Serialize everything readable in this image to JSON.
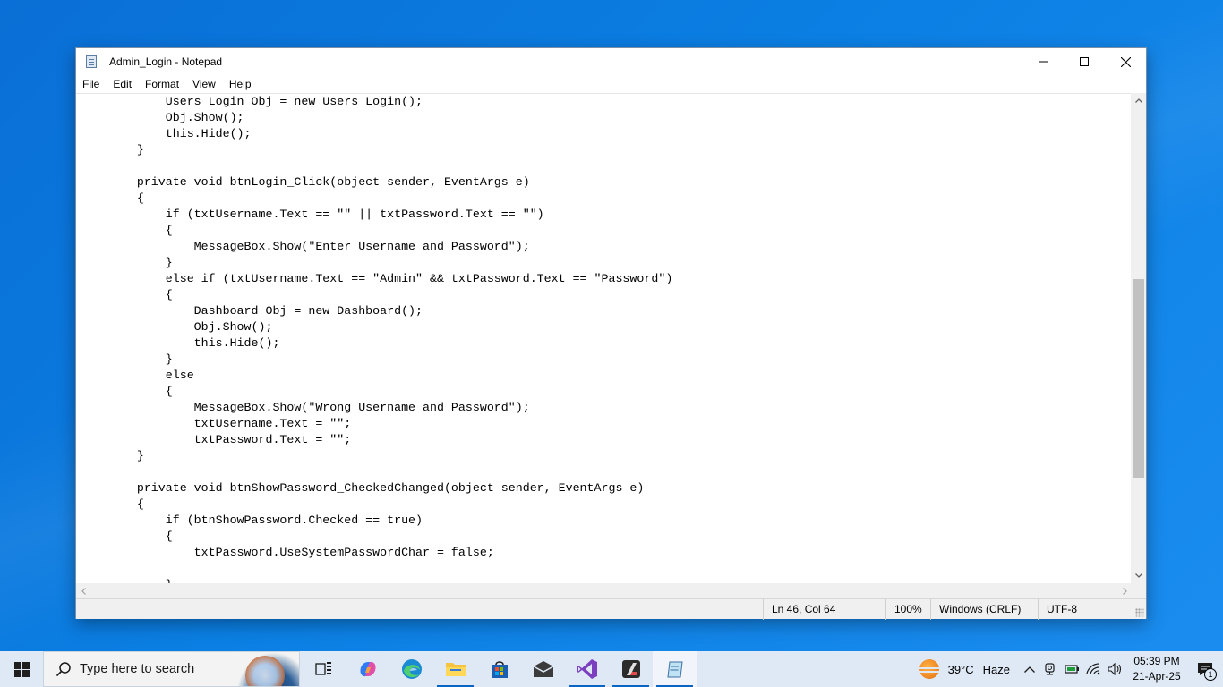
{
  "window": {
    "title": "Admin_Login - Notepad",
    "menu": [
      "File",
      "Edit",
      "Format",
      "View",
      "Help"
    ],
    "code_lines": [
      "            Users_Login Obj = new Users_Login();",
      "            Obj.Show();",
      "            this.Hide();",
      "        }",
      "",
      "        private void btnLogin_Click(object sender, EventArgs e)",
      "        {",
      "            if (txtUsername.Text == \"\" || txtPassword.Text == \"\")",
      "            {",
      "                MessageBox.Show(\"Enter Username and Password\");",
      "            }",
      "            else if (txtUsername.Text == \"Admin\" && txtPassword.Text == \"Password\")",
      "            {",
      "                Dashboard Obj = new Dashboard();",
      "                Obj.Show();",
      "                this.Hide();",
      "            }",
      "            else",
      "            {",
      "                MessageBox.Show(\"Wrong Username and Password\");",
      "                txtUsername.Text = \"\";",
      "                txtPassword.Text = \"\";",
      "        }",
      "",
      "        private void btnShowPassword_CheckedChanged(object sender, EventArgs e)",
      "        {",
      "            if (btnShowPassword.Checked == true)",
      "            {",
      "                txtPassword.UseSystemPasswordChar = false;",
      "",
      "            }"
    ],
    "status": {
      "position": "Ln 46, Col 64",
      "zoom": "100%",
      "line_ending": "Windows (CRLF)",
      "encoding": "UTF-8"
    }
  },
  "taskbar": {
    "search_placeholder": "Type here to search",
    "apps": [
      "task-view",
      "copilot",
      "edge",
      "file-explorer",
      "microsoft-store",
      "mail",
      "visual-studio",
      "terminal-app",
      "notepad"
    ],
    "weather": {
      "temperature": "39°C",
      "condition": "Haze"
    },
    "clock": {
      "time": "05:39 PM",
      "date": "21-Apr-25"
    },
    "notification_count": "1"
  },
  "colors": {
    "desktop": "#0b7fe3",
    "taskbar": "#dfe9f5",
    "accent": "#0a64c4"
  }
}
